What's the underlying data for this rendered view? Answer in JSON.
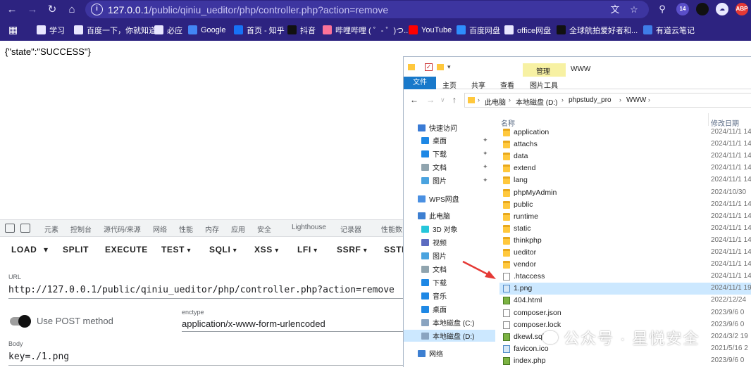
{
  "browser": {
    "url_host": "127.0.0.1",
    "url_path": "/public/qiniu_ueditor/php/controller.php?action=remove",
    "extension_badge": "14",
    "abp_label": "ABP"
  },
  "bookmarks": [
    {
      "label": "学习",
      "icon": "folder-icon",
      "color": "#e8e6ff"
    },
    {
      "label": "百度一下，你就知道",
      "icon": "doc-icon",
      "color": "#e8e6ff"
    },
    {
      "label": "必应",
      "icon": "bing-icon",
      "color": "#e8e6ff"
    },
    {
      "label": "Google",
      "icon": "google-icon",
      "color": "#4285f4"
    },
    {
      "label": "首页 - 知乎",
      "icon": "zhihu-icon",
      "color": "#1772f6"
    },
    {
      "label": "抖音",
      "icon": "douyin-icon",
      "color": "#111111"
    },
    {
      "label": "哔哩哔哩 ( ゜- ゜)つ...",
      "icon": "bilibili-icon",
      "color": "#fb7299"
    },
    {
      "label": "YouTube",
      "icon": "youtube-icon",
      "color": "#ff0000"
    },
    {
      "label": "百度网盘",
      "icon": "baidu-pan-icon",
      "color": "#2e8dfd"
    },
    {
      "label": "office网盘",
      "icon": "office-pan-icon",
      "color": "#e8e6ff"
    },
    {
      "label": "全球航拍爱好者和...",
      "icon": "skypixel-icon",
      "color": "#111111"
    },
    {
      "label": "有道云笔记",
      "icon": "youdao-icon",
      "color": "#3f7de8"
    }
  ],
  "page": {
    "response_text": "{\"state\":\"SUCCESS\"}"
  },
  "devtools": {
    "tabs": [
      "元素",
      "控制台",
      "源代码/来源",
      "网络",
      "性能",
      "内存",
      "应用",
      "安全",
      "Lighthouse",
      "记录器",
      "性能数"
    ],
    "hackbar_menu": [
      "LOAD",
      "SPLIT",
      "EXECUTE",
      "TEST",
      "SQLI",
      "XSS",
      "LFI",
      "SSRF",
      "SSTI"
    ],
    "url_label": "URL",
    "url_value": "http://127.0.0.1/public/qiniu_ueditor/php/controller.php?action=remove",
    "post_toggle_label": "Use POST method",
    "post_enabled": true,
    "enctype_label": "enctype",
    "enctype_value": "application/x-www-form-urlencoded",
    "body_label": "Body",
    "body_value": "key=./1.png"
  },
  "explorer": {
    "manage_tab": "管理",
    "window_title": "WWW",
    "ribbon_tabs": [
      "文件",
      "主页",
      "共享",
      "查看",
      "图片工具"
    ],
    "breadcrumb": [
      "此电脑",
      "本地磁盘 (D:)",
      "phpstudy_pro",
      "WWW"
    ],
    "nav": [
      {
        "label": "快速访问",
        "icon": "star-icon",
        "color": "#3a7bd5"
      },
      {
        "label": "桌面",
        "icon": "desktop-icon",
        "color": "#1e88e5",
        "pinned": true
      },
      {
        "label": "下载",
        "icon": "download-icon",
        "color": "#1e88e5",
        "pinned": true
      },
      {
        "label": "文档",
        "icon": "documents-icon",
        "color": "#90a4ae",
        "pinned": true
      },
      {
        "label": "图片",
        "icon": "pictures-icon",
        "color": "#4aa3df",
        "pinned": true
      },
      {
        "label": "WPS网盘",
        "icon": "cloud-icon",
        "color": "#4a90e2"
      },
      {
        "label": "此电脑",
        "icon": "computer-icon",
        "color": "#3d7fd1"
      },
      {
        "label": "3D 对象",
        "icon": "3d-objects-icon",
        "color": "#26c6da"
      },
      {
        "label": "视频",
        "icon": "videos-icon",
        "color": "#5c6bc0"
      },
      {
        "label": "图片",
        "icon": "pictures-icon",
        "color": "#4aa3df"
      },
      {
        "label": "文档",
        "icon": "documents-icon",
        "color": "#90a4ae"
      },
      {
        "label": "下载",
        "icon": "download-icon",
        "color": "#1e88e5"
      },
      {
        "label": "音乐",
        "icon": "music-icon",
        "color": "#1e88e5"
      },
      {
        "label": "桌面",
        "icon": "desktop-icon",
        "color": "#1e88e5"
      },
      {
        "label": "本地磁盘 (C:)",
        "icon": "drive-icon",
        "color": "#8aa4c0"
      },
      {
        "label": "本地磁盘 (D:)",
        "icon": "drive-icon",
        "color": "#8aa4c0",
        "selected": true
      },
      {
        "label": "网络",
        "icon": "network-icon",
        "color": "#3d7fd1"
      }
    ],
    "columns": {
      "name": "名称",
      "date": "修改日期"
    },
    "files": [
      {
        "name": "application",
        "date": "2024/11/1 14",
        "type": "folder"
      },
      {
        "name": "attachs",
        "date": "2024/11/1 14",
        "type": "folder"
      },
      {
        "name": "data",
        "date": "2024/11/1 14",
        "type": "folder"
      },
      {
        "name": "extend",
        "date": "2024/11/1 14",
        "type": "folder"
      },
      {
        "name": "lang",
        "date": "2024/11/1 14",
        "type": "folder"
      },
      {
        "name": "phpMyAdmin",
        "date": "2024/10/30",
        "type": "folder"
      },
      {
        "name": "public",
        "date": "2024/11/1 14",
        "type": "folder"
      },
      {
        "name": "runtime",
        "date": "2024/11/1 14",
        "type": "folder"
      },
      {
        "name": "static",
        "date": "2024/11/1 14",
        "type": "folder"
      },
      {
        "name": "thinkphp",
        "date": "2024/11/1 14",
        "type": "folder"
      },
      {
        "name": "ueditor",
        "date": "2024/11/1 14",
        "type": "folder"
      },
      {
        "name": "vendor",
        "date": "2024/11/1 14",
        "type": "folder"
      },
      {
        "name": ".htaccess",
        "date": "2024/11/1 14",
        "type": "doc"
      },
      {
        "name": "1.png",
        "date": "2024/11/1 19",
        "type": "image",
        "selected": true
      },
      {
        "name": "404.html",
        "date": "2022/12/24",
        "type": "green"
      },
      {
        "name": "composer.json",
        "date": "2023/9/6 0",
        "type": "doc"
      },
      {
        "name": "composer.lock",
        "date": "2023/9/6 0",
        "type": "doc"
      },
      {
        "name": "dkewl.sql",
        "date": "2024/3/2 19",
        "type": "green"
      },
      {
        "name": "favicon.ico",
        "date": "2021/5/16 2",
        "type": "image"
      },
      {
        "name": "index.php",
        "date": "2023/9/6 0",
        "type": "green"
      }
    ]
  },
  "watermark": "公众号 · 星悦安全"
}
